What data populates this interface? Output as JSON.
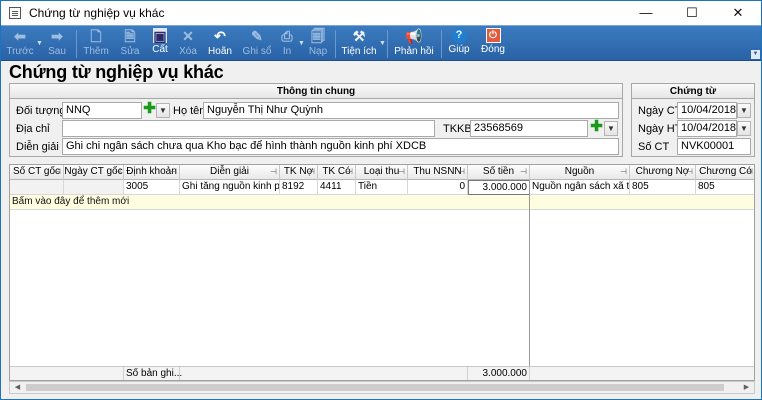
{
  "window": {
    "title": "Chứng từ nghiệp vụ khác",
    "min": "—",
    "max": "☐",
    "close": "✕"
  },
  "toolbar": {
    "prev": "Trước",
    "next": "Sau",
    "add": "Thêm",
    "edit": "Sửa",
    "save": "Cất",
    "delete": "Xóa",
    "undo": "Hoãn",
    "post": "Ghi sổ",
    "print": "In",
    "load": "Nạp",
    "utilities": "Tiện ích",
    "feedback": "Phản hồi",
    "help": "Giúp",
    "close": "Đóng"
  },
  "page_title": "Chứng từ nghiệp vụ khác",
  "general": {
    "header": "Thông tin chung",
    "object_label": "Đối tượng",
    "object_value": "NNQ",
    "name_label": "Họ tên",
    "name_value": "Nguyễn Thị Như Quỳnh",
    "address_label": "Địa chỉ",
    "address_value": "",
    "tkkb_label": "TKKB",
    "tkkb_value": "23568569",
    "desc_label": "Diễn giải",
    "desc_value": "Ghi chi ngân sách chưa qua Kho bạc để hình thành nguồn kinh phí XDCB"
  },
  "voucher": {
    "header": "Chứng từ",
    "date_ct_label": "Ngày CT",
    "date_ct": "10/04/2018",
    "date_ht_label": "Ngày HT",
    "date_ht": "10/04/2018",
    "no_label": "Số CT",
    "no_value": "NVK00001"
  },
  "grid": {
    "columns": [
      "Số CT gốc",
      "Ngày CT gốc",
      "Định khoản",
      "Diễn giải",
      "TK Nợ",
      "TK Có",
      "Loại thu",
      "Thu NSNN",
      "Số tiền",
      "Nguồn",
      "Chương Nợ",
      "Chương Có"
    ],
    "row": [
      "",
      "",
      "3005",
      "Ghi tăng nguồn kinh ph...",
      "8192",
      "4411",
      "Tiền",
      "0",
      "3.000.000",
      "Nguồn ngân sách xã tự...",
      "805",
      "805"
    ],
    "new_row_hint": "Bấm vào đây để thêm mới",
    "footer_count": "Số bản ghi...",
    "footer_total": "3.000.000"
  },
  "icons": {
    "pin": "⊣",
    "arrow_left": "◀",
    "arrow_right": "▶",
    "dropdown": "▼",
    "plus": "✚"
  }
}
